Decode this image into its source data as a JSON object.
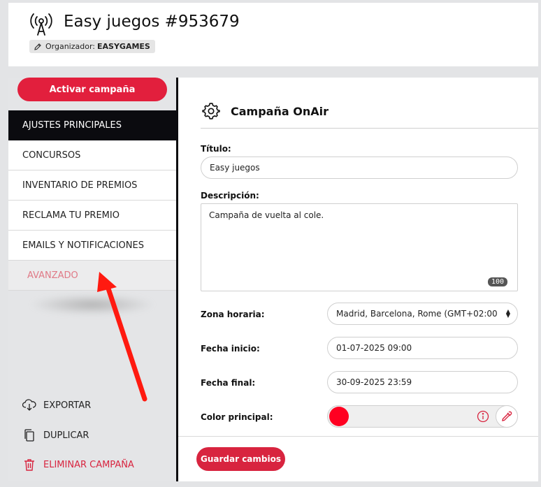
{
  "header": {
    "title": "Easy juegos #953679",
    "organizer_label": "Organizador:",
    "organizer_value": "EASYGAMES"
  },
  "sidebar": {
    "activate_label": "Activar campaña",
    "items": [
      {
        "label": "AJUSTES PRINCIPALES"
      },
      {
        "label": "CONCURSOS"
      },
      {
        "label": "INVENTARIO DE PREMIOS"
      },
      {
        "label": "RECLAMA TU PREMIO"
      },
      {
        "label": "EMAILS Y NOTIFICACIONES"
      },
      {
        "label": "AVANZADO"
      }
    ],
    "export_label": "EXPORTAR",
    "duplicate_label": "DUPLICAR",
    "delete_label": "ELIMINAR CAMPAÑA"
  },
  "panel": {
    "title": "Campaña OnAir",
    "title_label": "Título:",
    "title_value": "Easy juegos",
    "description_label": "Descripción:",
    "description_value": "Campaña de vuelta al cole.",
    "char_count": "100",
    "timezone_label": "Zona horaria:",
    "timezone_value": "Madrid, Barcelona, Rome (GMT+02:00",
    "start_label": "Fecha inicio:",
    "start_value": "01-07-2025 09:00",
    "end_label": "Fecha final:",
    "end_value": "30-09-2025 23:59",
    "color_label": "Color principal:",
    "color_value": "#ff0021",
    "save_label": "Guardar cambios"
  },
  "colors": {
    "accent": "#e21f3d",
    "active_menu": "#0b0b0f",
    "advanced_text": "#e07a87"
  }
}
